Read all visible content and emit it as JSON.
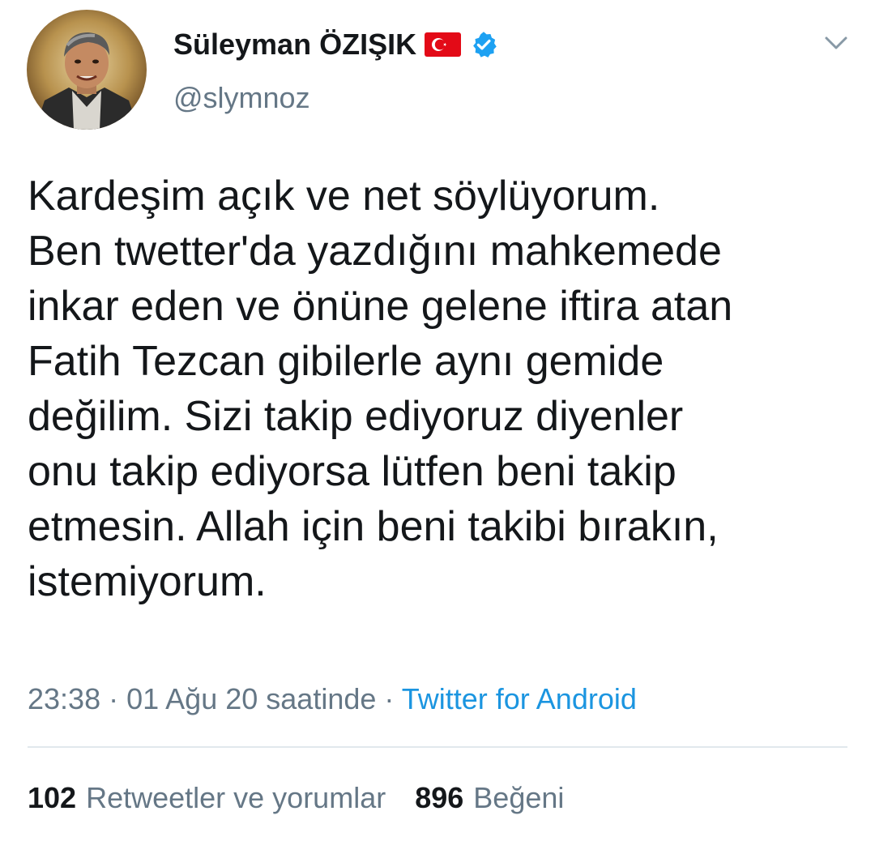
{
  "user": {
    "display_name": "Süleyman ÖZIŞIK",
    "handle": "@slymnoz",
    "flag": "turkish-flag-icon",
    "verified": "verified-badge-icon"
  },
  "tweet": {
    "text": "Kardeşim açık ve net söylüyorum.\nBen twetter'da yazdığını mahkemede\ninkar eden ve önüne gelene iftira atan\nFatih Tezcan gibilerle aynı gemide\ndeğilim. Sizi takip ediyoruz diyenler\nonu takip ediyorsa lütfen beni takip\netmesin. Allah için beni takibi bırakın,\nistemiyorum.",
    "time": "23:38",
    "separator": "·",
    "date": "01 Ağu 20 saatinde",
    "source": "Twitter for Android"
  },
  "stats": {
    "retweets_count": "102",
    "retweets_label": "Retweetler ve yorumlar",
    "likes_count": "896",
    "likes_label": "Beğeni"
  },
  "colors": {
    "text": "#14171a",
    "secondary": "#657786",
    "link": "#1b95e0",
    "divider": "#e1e8ed",
    "flag_red": "#e30a17",
    "verified_blue": "#1da1f2"
  }
}
